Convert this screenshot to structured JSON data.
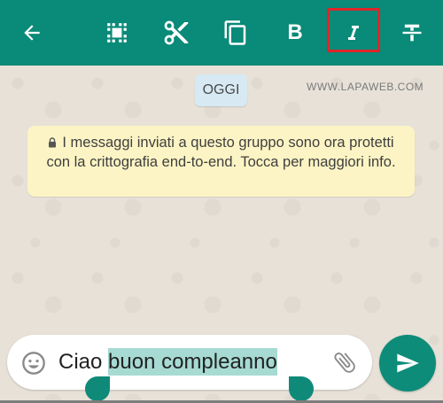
{
  "toolbar": {
    "color": "#0a8a78",
    "highlight_color": "#e0252a",
    "buttons": [
      {
        "icon": "arrow-back-icon"
      },
      {
        "icon": "select-all-icon"
      },
      {
        "icon": "scissors-icon"
      },
      {
        "icon": "copy-icon"
      },
      {
        "icon": "bold-icon",
        "glyph": "B"
      },
      {
        "icon": "italic-icon",
        "glyph": "I",
        "highlighted": true
      },
      {
        "icon": "strikethrough-icon"
      }
    ]
  },
  "chat": {
    "date_chip": "OGGI",
    "watermark": "WWW.LAPAWEB.COM",
    "encryption_notice": "I messaggi inviati a questo gruppo sono ora protetti con la crittografia end-to-end. Tocca per maggiori info."
  },
  "composer": {
    "text_before_selection": "Ciao ",
    "selected_text": "buon compleanno",
    "selection_color": "#a6dad3",
    "emoji_icon": "emoji-icon",
    "attach_icon": "paperclip-icon",
    "send_icon": "send-icon",
    "send_color": "#0d8c79"
  }
}
